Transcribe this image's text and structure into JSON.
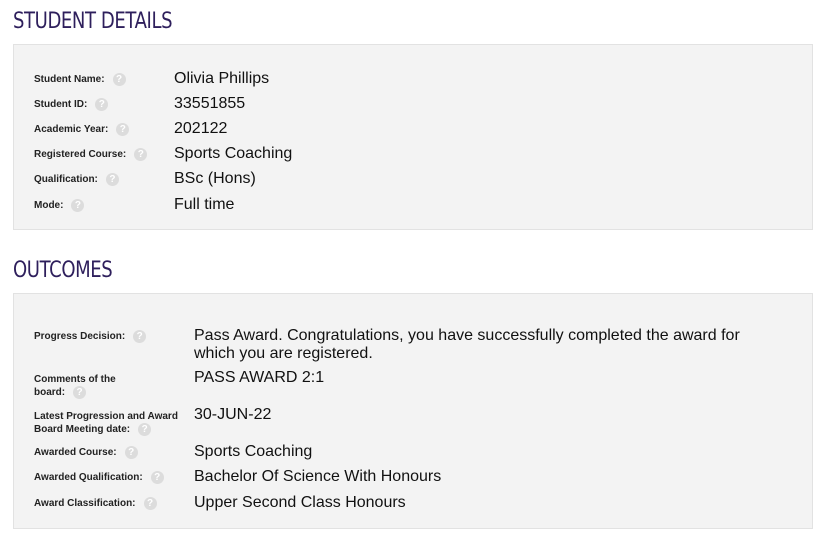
{
  "student_details": {
    "title": "STUDENT DETAILS",
    "fields": [
      {
        "label": "Student Name:",
        "value": "Olivia Phillips"
      },
      {
        "label": "Student ID:",
        "value": "33551855"
      },
      {
        "label": "Academic Year:",
        "value": "202122"
      },
      {
        "label": "Registered Course:",
        "value": "Sports Coaching"
      },
      {
        "label": "Qualification:",
        "value": "BSc (Hons)"
      },
      {
        "label": "Mode:",
        "value": "Full time"
      }
    ]
  },
  "outcomes": {
    "title": "OUTCOMES",
    "fields": [
      {
        "label": "Progress Decision:",
        "value_line1": "Pass Award. Congratulations, you have successfully completed the award for",
        "value_line2": "which you are registered."
      },
      {
        "label_line1": "Comments of the",
        "label_line2": "board:",
        "value": "PASS AWARD 2:1"
      },
      {
        "label_line1": "Latest Progression and Award",
        "label_line2": "Board Meeting date:",
        "value": "30-JUN-22"
      },
      {
        "label": "Awarded Course:",
        "value": "Sports Coaching"
      },
      {
        "label": "Awarded Qualification:",
        "value": "Bachelor Of Science With Honours"
      },
      {
        "label": "Award Classification:",
        "value": "Upper Second Class Honours"
      }
    ]
  },
  "icons": {
    "help": "question-mark-icon"
  },
  "colors": {
    "title": "#2e1f5c",
    "panel": "#f3f3f3",
    "help_icon": "#dcdcdc"
  }
}
